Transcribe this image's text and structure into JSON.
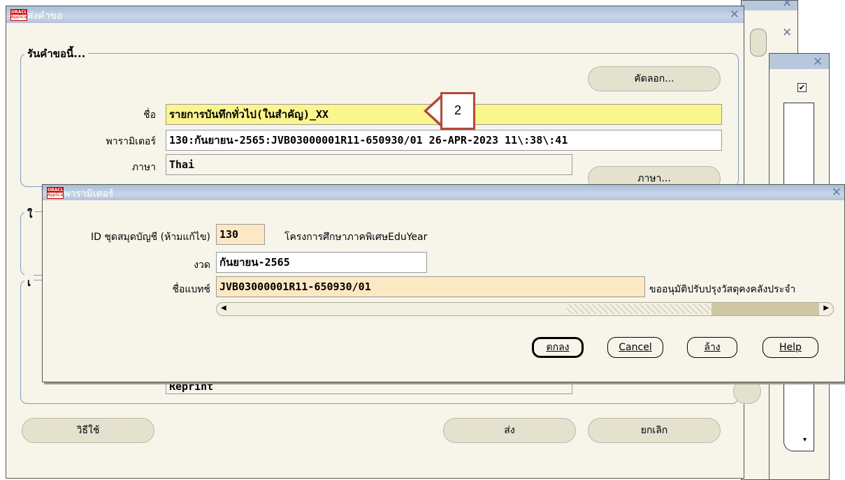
{
  "main_window": {
    "title": "ส่งคำขอ",
    "logo_text": [
      "ORACLE",
      "Applications"
    ],
    "section_request": "รันคำขอนี้...",
    "copy_button": "คัดลอก...",
    "name_label": "ชื่อ",
    "name_value": "รายการบันทึกทั่วไป(ในสำคัญ)_XX",
    "params_label": "พารามิเตอร์",
    "params_value": "130:กันยายน-2565:JVB03000001R11-650930/01 26-APR-2023 11\\:38\\:41",
    "language_label": "ภาษา",
    "language_value": "Thai",
    "language_button": "ภาษา...",
    "section2_prefix": "ใ",
    "section3_prefix": "เ",
    "hidden_value": "Reprint",
    "help_button": "วิธีใช้",
    "submit_button": "ส่ง",
    "cancel_button": "ยกเลิก"
  },
  "callout": {
    "number": "2"
  },
  "params_dialog": {
    "title": "พารามิเตอร์",
    "ledger_label": "ID ชุดสมุดบัญชี (ห้ามแก้ไข)",
    "ledger_value": "130",
    "ledger_desc": "โครงการศึกษาภาคพิเศษEduYear",
    "period_label": "งวด",
    "period_value": "กันยายน-2565",
    "batch_label": "ชื่อแบทช์",
    "batch_value": "JVB03000001R11-650930/01",
    "batch_desc": "ขออนุมัติปรับปรุงวัสดุคงคลังประจำ",
    "ok_button": "ตกลง",
    "cancel_button": "Cancel",
    "clear_button": "ล้าง",
    "help_button": "Help"
  },
  "colors": {
    "title_bar": "#b2c3dc",
    "window_bg": "#f7f4ea",
    "highlight_field": "#fbf58e",
    "readonly_field": "#fce9c3",
    "callout_border": "#b34a3a"
  }
}
